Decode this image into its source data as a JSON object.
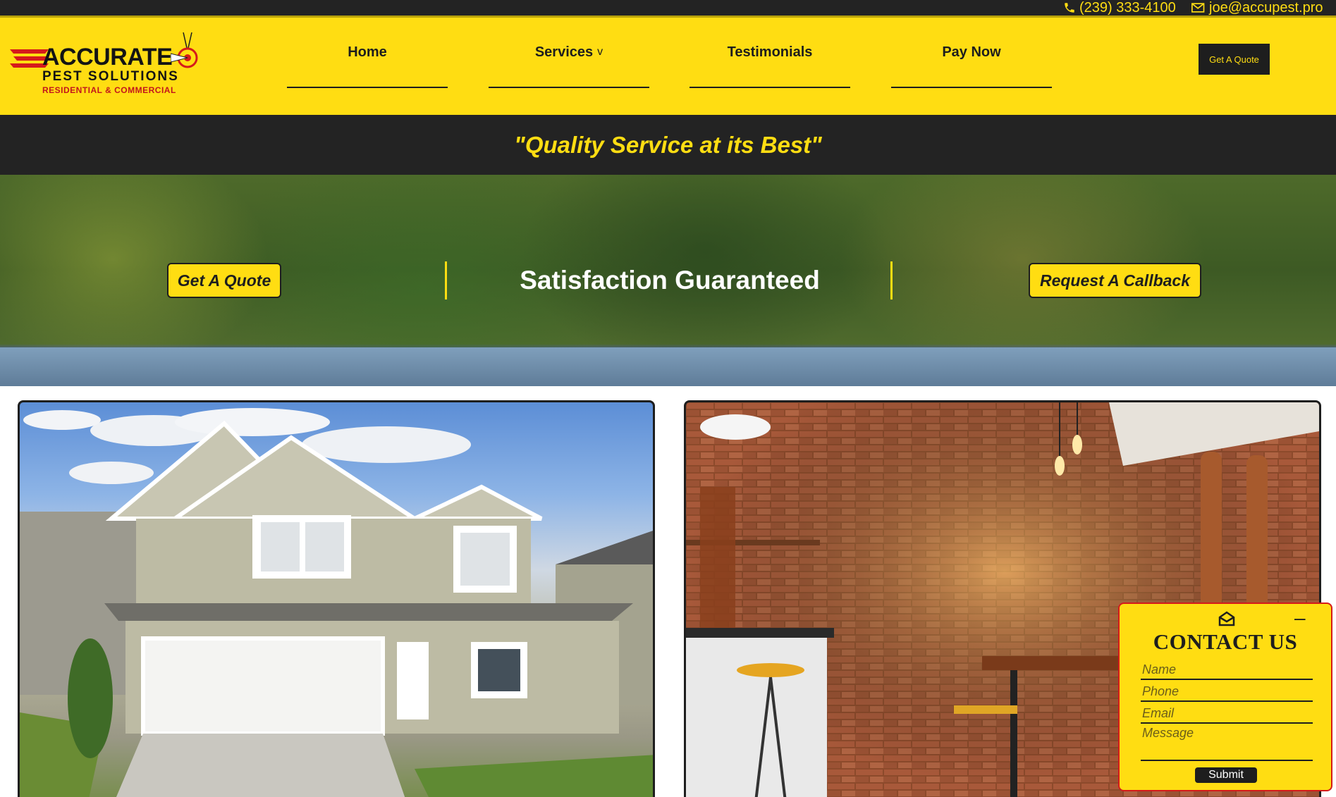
{
  "topbar": {
    "phone": "(239) 333-4100",
    "email": "joe@accupest.pro",
    "icons": [
      "phone-icon",
      "envelope-icon"
    ]
  },
  "logo": {
    "brand": "ACCURATE",
    "line1": "PEST SOLUTIONS",
    "line2": "RESIDENTIAL & COMMERCIAL"
  },
  "nav": {
    "home": "Home",
    "services": "Services",
    "services_chevron": "v",
    "testimonials": "Testimonials",
    "pay_now": "Pay Now",
    "quote_button": "Get A Quote"
  },
  "tagline": "\"Quality Service at its Best\"",
  "hero": {
    "quote_button": "Get A Quote",
    "title": "Satisfaction Guaranteed",
    "callback_button": "Request A Callback"
  },
  "contact_widget": {
    "title": "CONTACT US",
    "name_placeholder": "Name",
    "phone_placeholder": "Phone",
    "email_placeholder": "Email",
    "message_placeholder": "Message",
    "submit": "Submit",
    "minimize": "–"
  },
  "colors": {
    "brand_yellow": "#ffdd12",
    "dark": "#232323",
    "accent_red": "#d51b1b"
  }
}
